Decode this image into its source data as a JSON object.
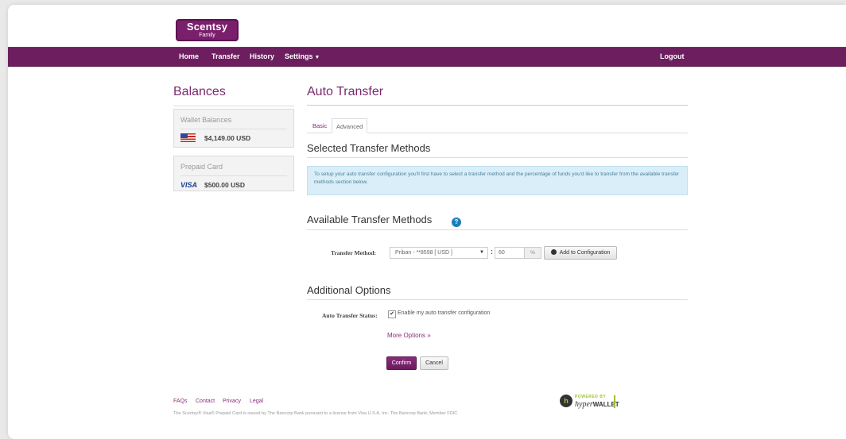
{
  "brand": {
    "name": "Scentsy",
    "sub": "Family"
  },
  "nav": {
    "home": "Home",
    "transfer": "Transfer",
    "history": "History",
    "settings": "Settings",
    "logout": "Logout"
  },
  "sidebar": {
    "title": "Balances",
    "wallet": {
      "title": "Wallet Balances",
      "amount": "$4,149.00 USD",
      "icon": "us-flag-icon"
    },
    "prepaid": {
      "title": "Prepaid Card",
      "card": "VISA",
      "amount": "$500.00 USD"
    }
  },
  "main": {
    "title": "Auto Transfer",
    "tabs": [
      {
        "label": "Basic"
      },
      {
        "label": "Advanced"
      }
    ],
    "selected": {
      "title": "Selected Transfer Methods",
      "info": "To setup your auto transfer configuration you'll first have to select a transfer method and the percentage of funds you'd like to transfer from the available transfer methods section below."
    },
    "available": {
      "title": "Available Transfer Methods",
      "help": "?",
      "method_label": "Transfer Method:",
      "method_value": "Priban - **8598 [ USD ]",
      "colon": ":",
      "percent_value": "60",
      "percent_addon": "%",
      "add_button": "Add to Configuration"
    },
    "additional": {
      "title": "Additional Options",
      "status_label": "Auto Transfer Status:",
      "checkbox_checked": true,
      "checkbox_label": "Enable my auto transfer configuration",
      "more_link": "More Options »"
    },
    "confirm": "Confirm",
    "cancel": "Cancel"
  },
  "footer": {
    "links": [
      "FAQs",
      "Contact",
      "Privacy",
      "Legal"
    ],
    "note": "The Scentsy® Visa® Prepaid Card is issued by The Bancorp Bank pursuant to a license from Visa U.S.A. Inc. The Bancorp Bank; Member FDIC.",
    "powered_by": "POWERED BY",
    "hyper": "hyper",
    "wallet": "WALLET"
  },
  "colors": {
    "brand": "#6c1e5f",
    "accent": "#7a2a6c",
    "info_bg": "#d9eef8"
  }
}
